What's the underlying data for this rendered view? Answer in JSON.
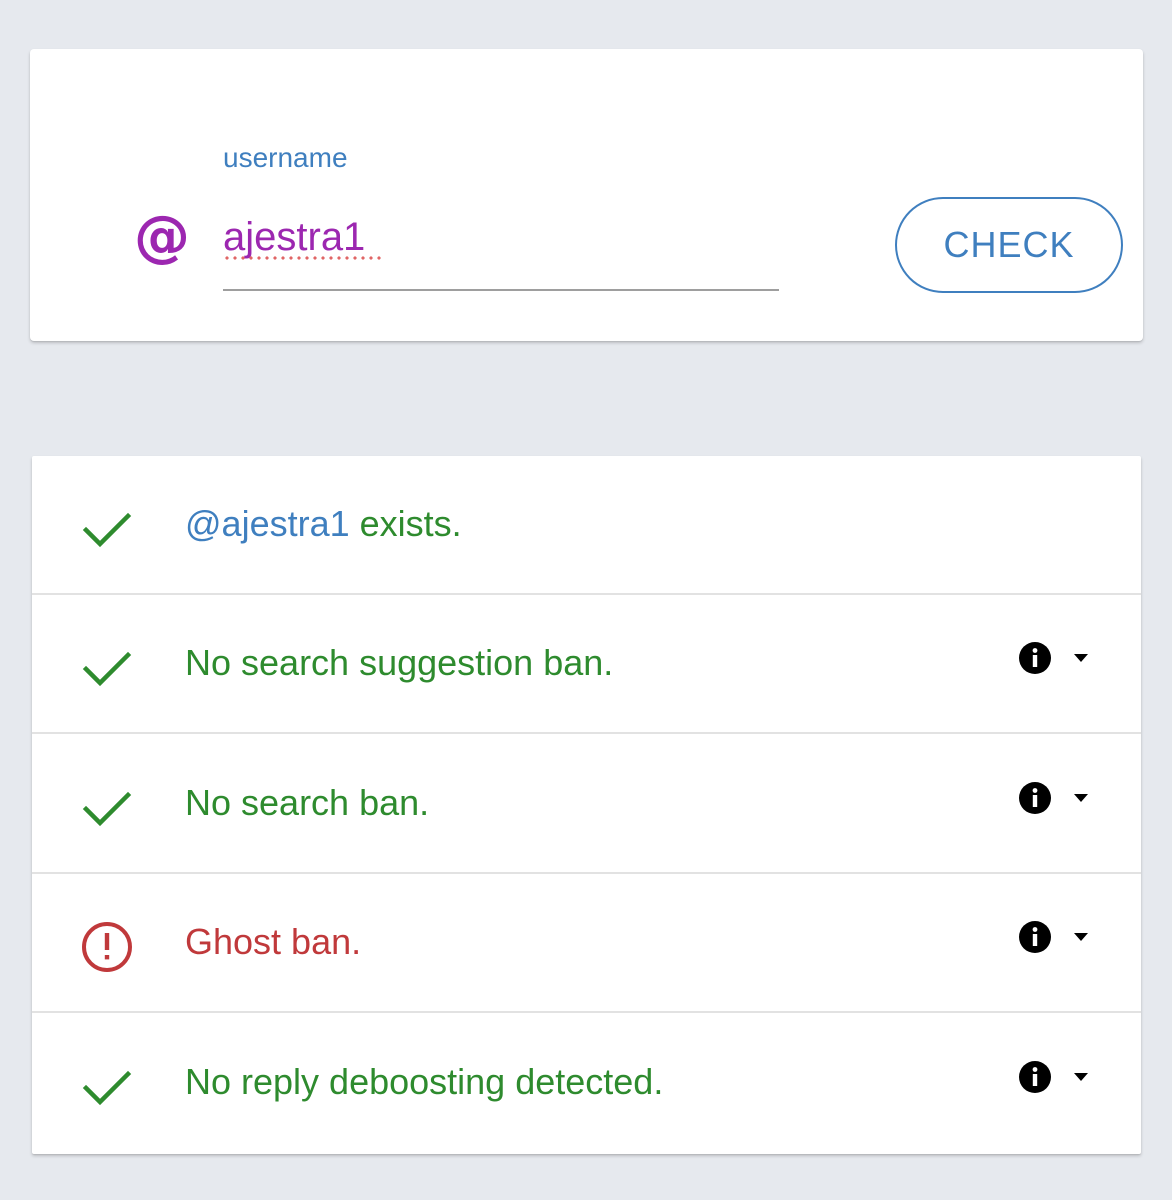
{
  "search": {
    "label": "username",
    "at_symbol": "@",
    "value": "ajestra1",
    "button_label": "CHECK",
    "label_color": "#3f7fbf",
    "accent_color": "#9c27b0"
  },
  "results": [
    {
      "status": "ok",
      "icon": "check-icon",
      "handle": "@ajestra1",
      "text": " exists.",
      "has_info": false
    },
    {
      "status": "ok",
      "icon": "check-icon",
      "text": "No search suggestion ban.",
      "has_info": true
    },
    {
      "status": "ok",
      "icon": "check-icon",
      "text": "No search ban.",
      "has_info": true
    },
    {
      "status": "error",
      "icon": "alert-circle-icon",
      "text": "Ghost ban.",
      "has_info": true
    },
    {
      "status": "ok",
      "icon": "check-icon",
      "text": "No reply deboosting detected.",
      "has_info": true
    }
  ],
  "colors": {
    "ok": "#2e8b2e",
    "error": "#c0393b",
    "link": "#3f7fbf",
    "background": "#e6e9ee"
  }
}
